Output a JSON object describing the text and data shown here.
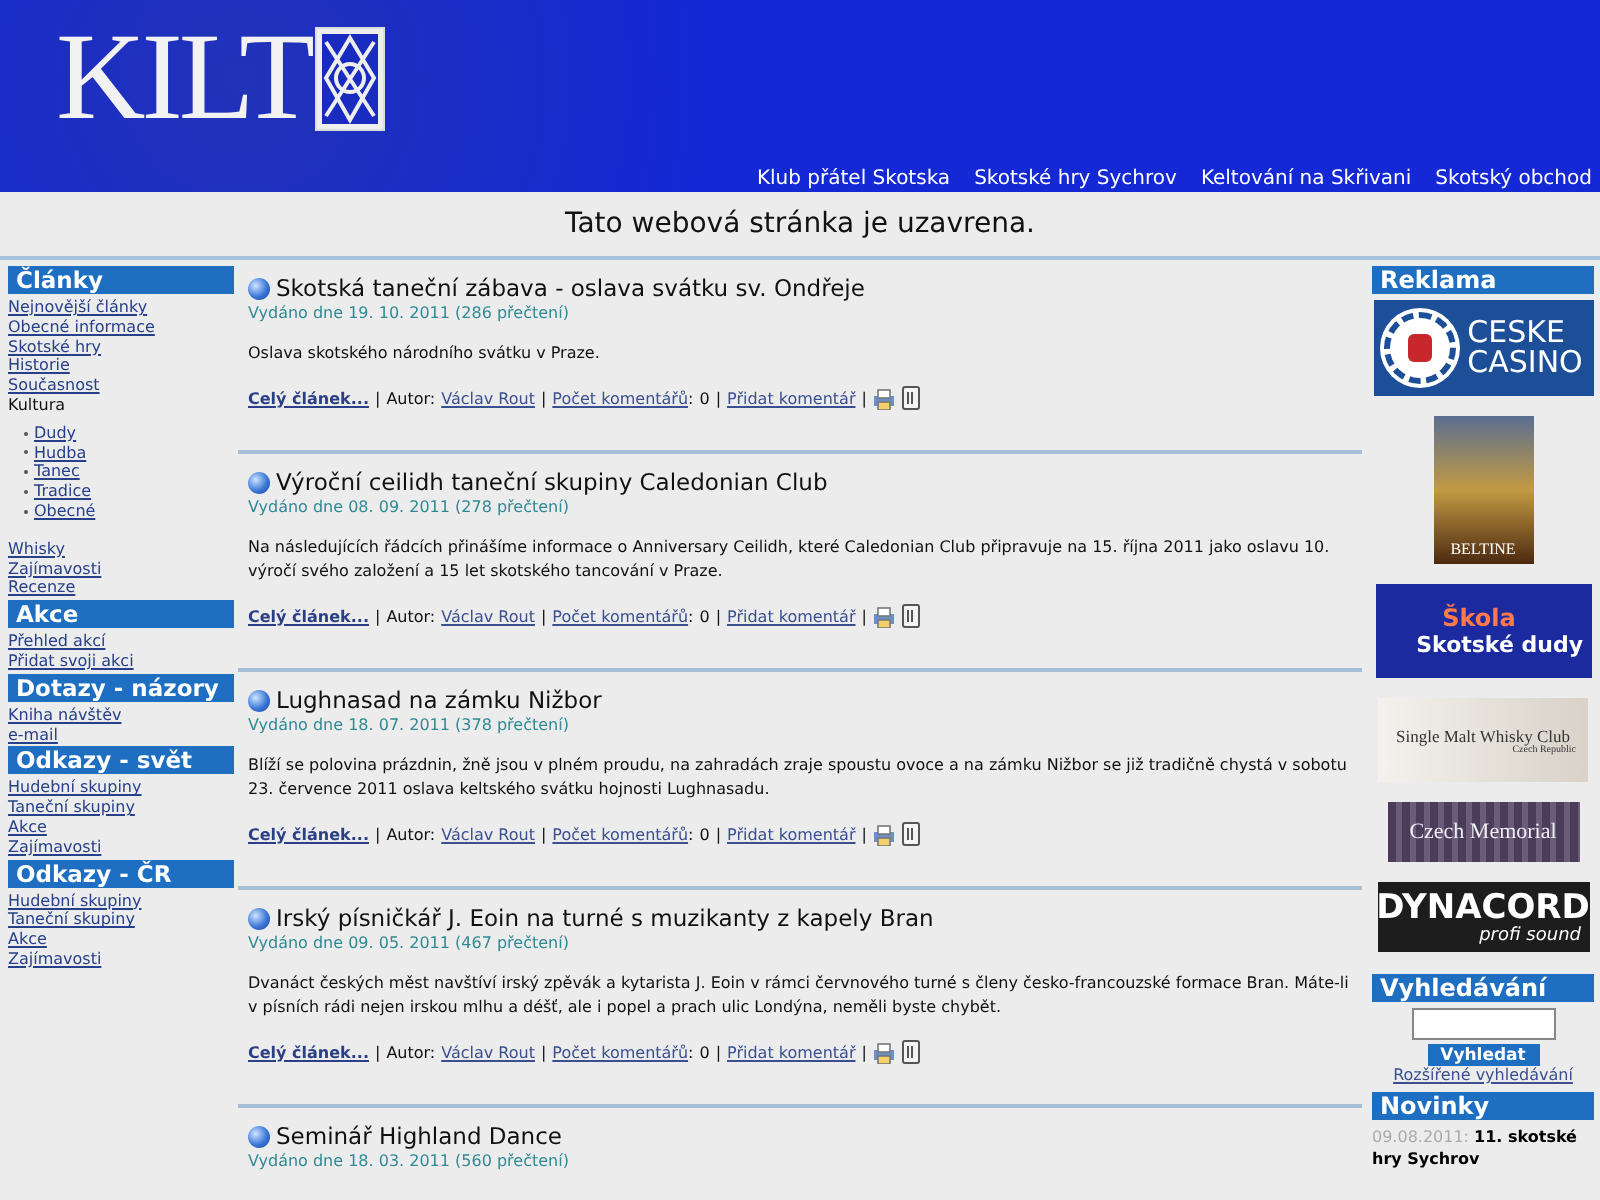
{
  "header": {
    "logo": "KILT",
    "nav": [
      "Klub přátel Skotska",
      "Skotské hry Sychrov",
      "Keltování na Skřivani",
      "Skotský obchod"
    ]
  },
  "notice": "Tato webová stránka je uzavrena.",
  "sidebar": [
    {
      "title": "Články",
      "items": [
        {
          "kind": "link",
          "label": "Nejnovější články"
        },
        {
          "kind": "link",
          "label": "Obecné informace"
        },
        {
          "kind": "link",
          "label": "Skotské hry"
        },
        {
          "kind": "link",
          "label": "Historie"
        },
        {
          "kind": "link",
          "label": "Současnost"
        },
        {
          "kind": "text",
          "label": "Kultura",
          "children": [
            {
              "kind": "link",
              "label": "Dudy"
            },
            {
              "kind": "link",
              "label": "Hudba"
            },
            {
              "kind": "link",
              "label": "Tanec"
            },
            {
              "kind": "link",
              "label": "Tradice"
            },
            {
              "kind": "link",
              "label": "Obecné"
            }
          ]
        },
        {
          "kind": "link",
          "label": "Whisky"
        },
        {
          "kind": "link",
          "label": "Zajímavosti"
        },
        {
          "kind": "link",
          "label": "Recenze"
        }
      ]
    },
    {
      "title": "Akce",
      "items": [
        {
          "kind": "link",
          "label": "Přehled akcí"
        },
        {
          "kind": "link",
          "label": "Přidat svoji akci"
        }
      ]
    },
    {
      "title": "Dotazy - názory",
      "items": [
        {
          "kind": "link",
          "label": "Kniha návštěv"
        },
        {
          "kind": "link",
          "label": "e-mail"
        }
      ]
    },
    {
      "title": "Odkazy - svět",
      "items": [
        {
          "kind": "link",
          "label": "Hudební skupiny"
        },
        {
          "kind": "link",
          "label": "Taneční skupiny"
        },
        {
          "kind": "link",
          "label": "Akce"
        },
        {
          "kind": "link",
          "label": "Zajímavosti"
        }
      ]
    },
    {
      "title": "Odkazy - ČR",
      "items": [
        {
          "kind": "link",
          "label": "Hudební skupiny"
        },
        {
          "kind": "link",
          "label": "Taneční skupiny"
        },
        {
          "kind": "link",
          "label": "Akce"
        },
        {
          "kind": "link",
          "label": "Zajímavosti"
        }
      ]
    }
  ],
  "articles": [
    {
      "title": "Skotská taneční zábava - oslava svátku sv. Ondřeje",
      "meta": "Vydáno dne 19. 10. 2011 (286 přečtení)",
      "summary": "Oslava skotského národního svátku v Praze.",
      "more": "Celý článek...",
      "author_label": "Autor:",
      "author": "Václav Rout",
      "comments_label": "Počet komentářů",
      "colon": ":",
      "comments": "0",
      "add_comment": "Přidat komentář",
      "separator": "|"
    },
    {
      "title": "Výroční ceilidh taneční skupiny Caledonian Club",
      "meta": "Vydáno dne 08. 09. 2011 (278 přečtení)",
      "summary": "Na následujících řádcích přinášíme informace o Anniversary Ceilidh, které Caledonian Club připravuje na 15. října 2011 jako oslavu 10. výročí svého založení a 15 let skotského tancování v Praze.",
      "more": "Celý článek...",
      "author_label": "Autor:",
      "author": "Václav Rout",
      "comments_label": "Počet komentářů",
      "colon": ":",
      "comments": "0",
      "add_comment": "Přidat komentář",
      "separator": "|"
    },
    {
      "title": "Lughnasad na zámku Nižbor",
      "meta": "Vydáno dne 18. 07. 2011 (378 přečtení)",
      "summary": "Blíží se polovina prázdnin, žně jsou v plném proudu, na zahradách zraje spoustu ovoce a na zámku Nižbor se již tradičně chystá v sobotu 23. července 2011 oslava keltského svátku hojnosti Lughnasadu.",
      "more": "Celý článek...",
      "author_label": "Autor:",
      "author": "Václav Rout",
      "comments_label": "Počet komentářů",
      "colon": ":",
      "comments": "0",
      "add_comment": "Přidat komentář",
      "separator": "|"
    },
    {
      "title": "Irský písničkář J. Eoin na turné s muzikanty z kapely Bran",
      "meta": "Vydáno dne 09. 05. 2011 (467 přečtení)",
      "summary": "Dvanáct českých měst navštíví irský zpěvák a kytarista J. Eoin v rámci červnového turné s členy česko-francouzské formace Bran. Máte-li v písních rádi nejen irskou mlhu a déšť, ale i popel a prach ulic Londýna, neměli byste chybět.",
      "more": "Celý článek...",
      "author_label": "Autor:",
      "author": "Václav Rout",
      "comments_label": "Počet komentářů",
      "colon": ":",
      "comments": "0",
      "add_comment": "Přidat komentář",
      "separator": "|"
    },
    {
      "title": "Seminář Highland Dance",
      "meta": "Vydáno dne 18. 03. 2011 (560 přečtení)"
    }
  ],
  "ads": {
    "title": "Reklama",
    "banners": [
      {
        "kind": "casino",
        "lines": [
          "CESKE",
          "CASINO"
        ]
      },
      {
        "kind": "poster",
        "lines": [
          "BELTINE"
        ]
      },
      {
        "kind": "school",
        "lines": [
          "Škola",
          "Skotské dudy"
        ]
      },
      {
        "kind": "whisky",
        "lines": [
          "Single Malt Whisky Club",
          "Czech Republic"
        ]
      },
      {
        "kind": "memorial",
        "lines": [
          "Czech Memorial"
        ]
      },
      {
        "kind": "dynacord",
        "lines": [
          "DYNACORD",
          "profi sound"
        ]
      }
    ]
  },
  "search": {
    "title": "Vyhledávání",
    "button": "Vyhledat",
    "advanced": "Rozšířené vyhledávání"
  },
  "news": {
    "title": "Novinky",
    "items": [
      {
        "date": "09.08.2011:",
        "title": "11. skotské hry Sychrov"
      }
    ]
  }
}
